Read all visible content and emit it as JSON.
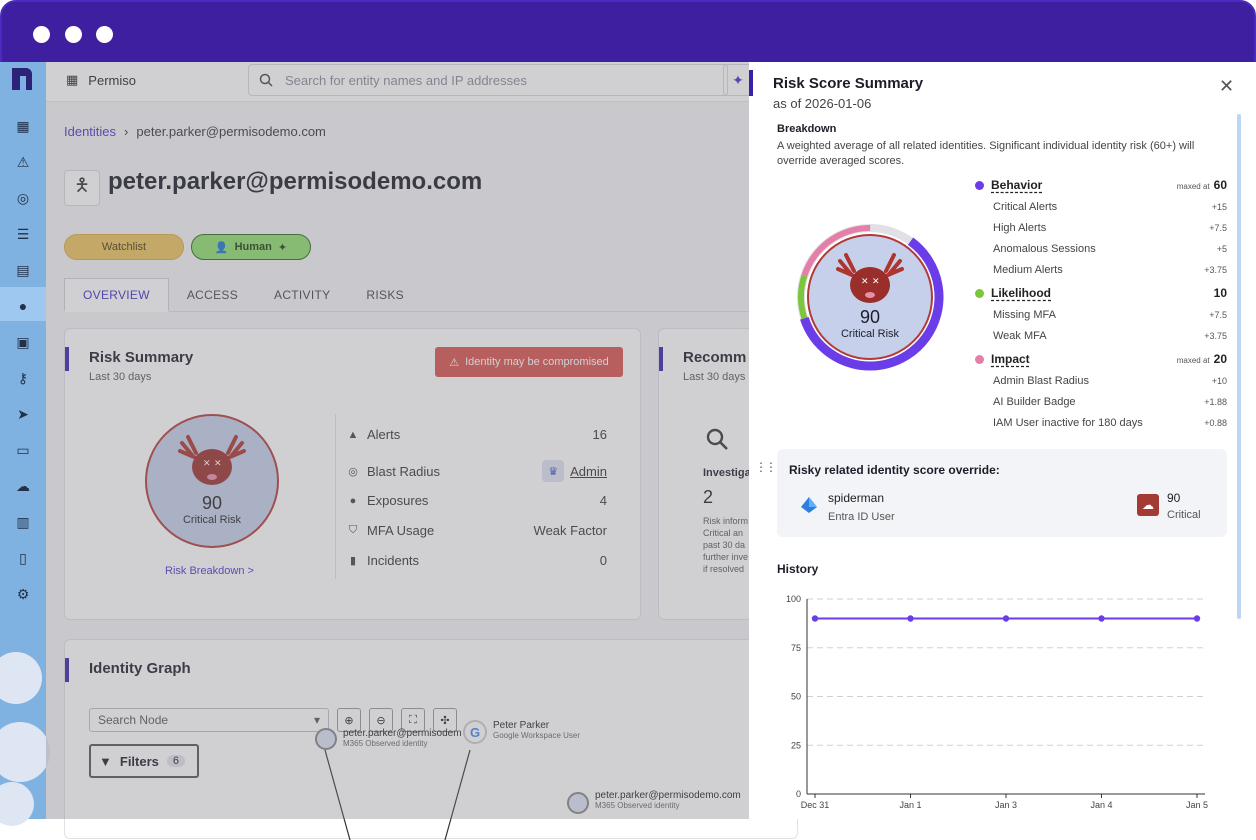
{
  "window": {
    "dots": 3
  },
  "topbar": {
    "org_name": "Permiso",
    "search_placeholder": "Search for entity names and IP addresses"
  },
  "breadcrumb": {
    "root": "Identities",
    "separator": "›",
    "current": "peter.parker@permisodemo.com"
  },
  "identity": {
    "title": "peter.parker@permisodemo.com",
    "tags": {
      "watchlist": "Watchlist",
      "human": "Human"
    }
  },
  "tabs": [
    "OVERVIEW",
    "ACCESS",
    "ACTIVITY",
    "RISKS"
  ],
  "risk_summary": {
    "title": "Risk Summary",
    "subtitle": "Last 30 days",
    "alert_badge": "Identity may be compromised",
    "score": "90",
    "level": "Critical Risk",
    "breakdown_link": "Risk Breakdown >",
    "metrics": [
      {
        "label": "Alerts",
        "value": "16"
      },
      {
        "label": "Blast Radius",
        "value": "Admin"
      },
      {
        "label": "Exposures",
        "value": "4"
      },
      {
        "label": "MFA Usage",
        "value": "Weak Factor"
      },
      {
        "label": "Incidents",
        "value": "0"
      }
    ]
  },
  "recommend": {
    "title": "Recomm",
    "subtitle": "Last 30 days",
    "investig": "Investiga",
    "count": "2",
    "lines": [
      "Risk inform",
      "Critical an",
      "past 30 da",
      "further inve",
      "if resolved"
    ]
  },
  "graph": {
    "title": "Identity Graph",
    "search_node": "Search Node",
    "filters_label": "Filters",
    "filters_count": "6",
    "nodes": [
      {
        "name": "peter.parker@permisodem",
        "type": "M365 Observed identity"
      },
      {
        "name": "Peter Parker",
        "type": "Google Workspace User"
      },
      {
        "name": "peter.parker@permisodemo.com",
        "type": "M365 Observed identity"
      }
    ]
  },
  "panel": {
    "title": "Risk Score Summary",
    "date": "as of 2026-01-06",
    "breakdown_title": "Breakdown",
    "breakdown_desc": "A weighted average of all related identities. Significant individual identity risk (60+) will override averaged scores.",
    "score": "90",
    "level": "Critical Risk",
    "maxed_label": "maxed at",
    "categories": [
      {
        "name": "Behavior",
        "color": "#6a3de8",
        "maxed": true,
        "total": "60",
        "items": [
          {
            "label": "Critical Alerts",
            "value": "+15"
          },
          {
            "label": "High Alerts",
            "value": "+7.5"
          },
          {
            "label": "Anomalous Sessions",
            "value": "+5"
          },
          {
            "label": "Medium Alerts",
            "value": "+3.75"
          }
        ]
      },
      {
        "name": "Likelihood",
        "color": "#7cc63e",
        "maxed": false,
        "total": "10",
        "items": [
          {
            "label": "Missing MFA",
            "value": "+7.5"
          },
          {
            "label": "Weak MFA",
            "value": "+3.75"
          }
        ]
      },
      {
        "name": "Impact",
        "color": "#e47fa8",
        "maxed": true,
        "total": "20",
        "items": [
          {
            "label": "Admin Blast Radius",
            "value": "+10"
          },
          {
            "label": "AI Builder Badge",
            "value": "+1.88"
          },
          {
            "label": "IAM User inactive for 180 days",
            "value": "+0.88"
          }
        ]
      }
    ],
    "donut": {
      "segments": [
        {
          "name": "Behavior",
          "value": 60,
          "color": "#6a3de8"
        },
        {
          "name": "Likelihood",
          "value": 10,
          "color": "#7cc63e"
        },
        {
          "name": "Impact",
          "value": 20,
          "color": "#e47fa8"
        }
      ],
      "max": 100
    },
    "override": {
      "title": "Risky related identity score override:",
      "name": "spiderman",
      "type": "Entra ID User",
      "score": "90",
      "level": "Critical"
    },
    "history_title": "History"
  },
  "chart_data": {
    "type": "line",
    "x": [
      "Dec 31",
      "Jan 1",
      "Jan 3",
      "Jan 4",
      "Jan 5"
    ],
    "series": [
      {
        "values": [
          90,
          90,
          90,
          90,
          90
        ]
      }
    ],
    "yticks": [
      0,
      25,
      50,
      75,
      100
    ],
    "ylim": [
      0,
      100
    ],
    "grid": true,
    "color": "#6a3de8"
  }
}
